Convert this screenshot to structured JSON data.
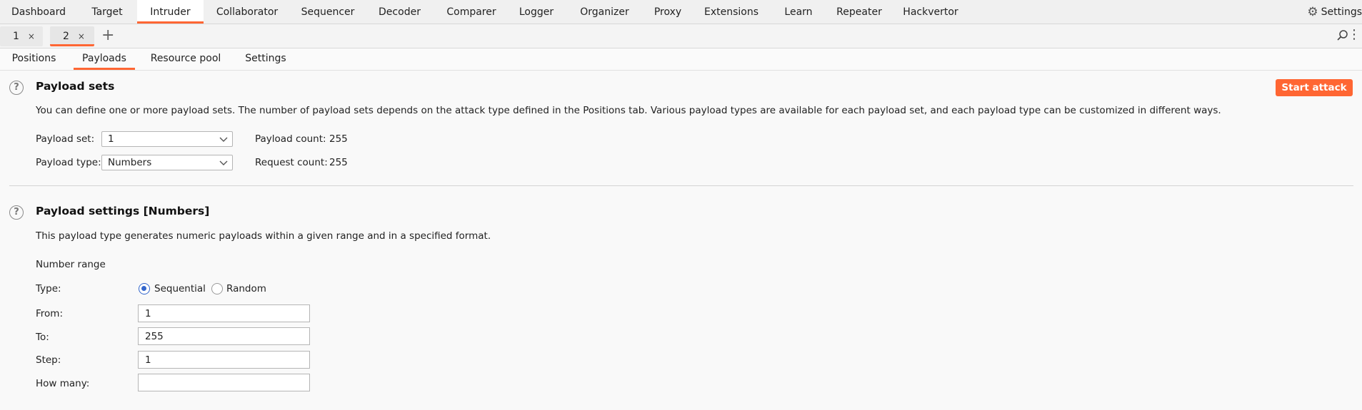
{
  "top_tabs": [
    "Dashboard",
    "Target",
    "Intruder",
    "Collaborator",
    "Sequencer",
    "Decoder",
    "Comparer",
    "Logger",
    "Organizer",
    "Proxy",
    "Extensions",
    "Learn",
    "Repeater",
    "Hackvertor"
  ],
  "top_active": "Intruder",
  "settings_label": "Settings",
  "request_tabs": [
    {
      "label": "1"
    },
    {
      "label": "2"
    }
  ],
  "close_glyph": "×",
  "add_glyph": "+",
  "sub_tabs": [
    "Positions",
    "Payloads",
    "Resource pool",
    "Settings"
  ],
  "sub_active": "Payloads",
  "payload_sets": {
    "title": "Payload sets",
    "description": "You can define one or more payload sets. The number of payload sets depends on the attack type defined in the Positions tab. Various payload types are available for each payload set, and each payload type can be customized in different ways.",
    "start_attack": "Start attack",
    "set_label": "Payload set:",
    "set_value": "1",
    "type_label": "Payload type:",
    "type_value": "Numbers",
    "payload_count_label": "Payload count:",
    "payload_count": "255",
    "request_count_label": "Request count:",
    "request_count": "255"
  },
  "payload_settings": {
    "title": "Payload settings [Numbers]",
    "description": "This payload type generates numeric payloads within a given range and in a specified format.",
    "number_range_label": "Number range",
    "type_label": "Type:",
    "type_options": [
      "Sequential",
      "Random"
    ],
    "type_selected": "Sequential",
    "from_label": "From:",
    "from_value": "1",
    "to_label": "To:",
    "to_value": "255",
    "step_label": "Step:",
    "step_value": "1",
    "howmany_label": "How many:",
    "howmany_value": ""
  },
  "colors": {
    "accent": "#ff6633",
    "radio": "#3366cc"
  },
  "icons": [
    "gear-icon",
    "close-icon",
    "plus-icon",
    "search-icon",
    "more-vertical-icon",
    "help-icon",
    "chevron-down-icon"
  ]
}
